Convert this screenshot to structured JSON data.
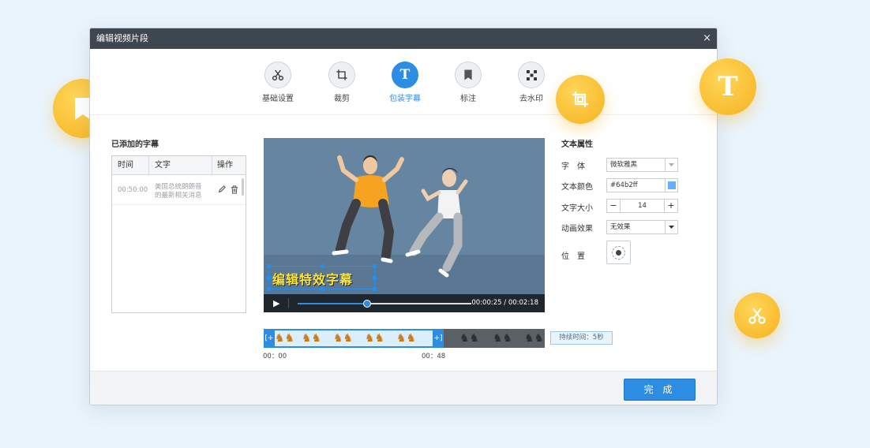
{
  "dialog": {
    "title": "编辑视频片段",
    "close_glyph": "×"
  },
  "toolbar": {
    "tools": [
      {
        "label": "基础设置",
        "icon": "scissors-icon"
      },
      {
        "label": "裁剪",
        "icon": "crop-icon"
      },
      {
        "label": "包装字幕",
        "icon": "text-icon",
        "active": true
      },
      {
        "label": "标注",
        "icon": "bookmark-icon"
      },
      {
        "label": "去水印",
        "icon": "mosaic-icon"
      }
    ]
  },
  "subtitles": {
    "section_title": "已添加的字幕",
    "columns": [
      "时间",
      "文字",
      "操作"
    ],
    "rows": [
      {
        "time": "00:50:00",
        "text_line1": "美国总统朗朗普",
        "text_line2": "的最新相关消息"
      }
    ]
  },
  "preview": {
    "caption": "编辑特效字幕",
    "play_glyph": "▶",
    "current_time": "00:00:25",
    "total_time": "00:02:18",
    "timecode": "00:00:25 / 00:02:18",
    "progress_fraction": 0.4
  },
  "timeline": {
    "start_label": "00：00",
    "end_label": "00：48",
    "duration_label": "持续时间：5秒",
    "left_handle": "[+",
    "right_handle": "+]"
  },
  "text_properties": {
    "section_title": "文本属性",
    "font_label": "字　体",
    "font_value": "微软雅黑",
    "color_label": "文本颜色",
    "color_value": "#64b2ff",
    "size_label": "文字大小",
    "size_value": "14",
    "minus": "−",
    "plus": "+",
    "animation_label": "动画效果",
    "animation_value": "无效果",
    "position_label": "位　置"
  },
  "footer": {
    "done_label": "完 成"
  },
  "colors": {
    "accent": "#2d8de3",
    "titlebar": "#3e4650",
    "caption": "#ffe234",
    "text_color_swatch": "#64b2ff",
    "bubble": "#f8b82a"
  },
  "decorations": [
    "bookmark-icon",
    "mosaic-icon",
    "crop-icon",
    "text-icon",
    "scissors-icon"
  ]
}
